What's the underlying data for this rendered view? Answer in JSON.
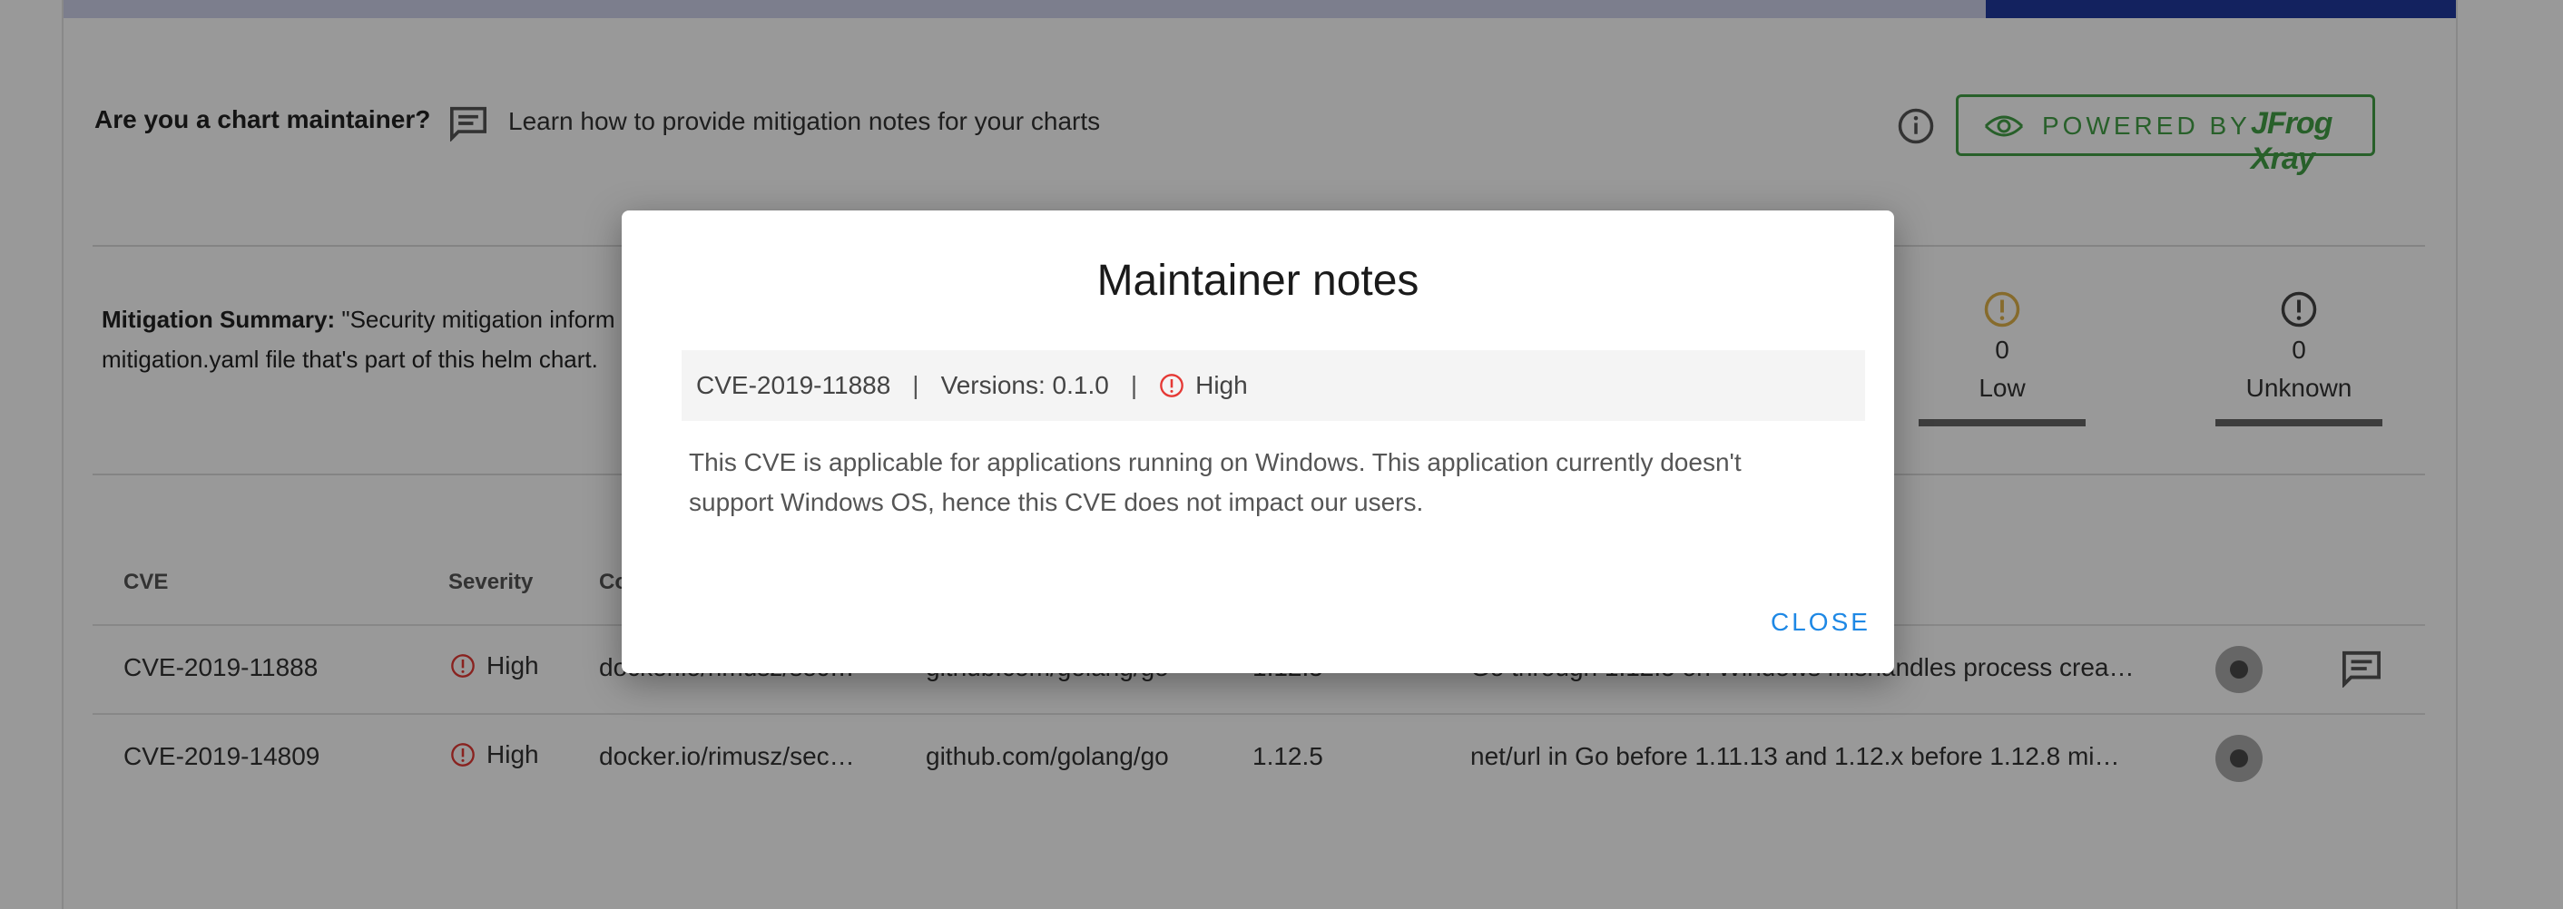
{
  "header": {
    "maintainer_question": "Are you a chart maintainer?",
    "maintainer_link": "Learn how to provide mitigation notes for your charts",
    "powered_by": "POWERED BY",
    "powered_brand": "JFrog Xray",
    "brand_color": "#43a047"
  },
  "summary": {
    "label": "Mitigation Summary:",
    "text_line1": " \"Security mitigation inform",
    "text_line2": "mitigation.yaml file that's part of this helm chart."
  },
  "severity_counts": [
    {
      "label": "Low",
      "count": "0",
      "color": "#e0b24a"
    },
    {
      "label": "Unknown",
      "count": "0",
      "color": "#444444"
    }
  ],
  "table": {
    "headers": {
      "cve": "CVE",
      "severity": "Severity",
      "component": "Co"
    },
    "rows": [
      {
        "cve": "CVE-2019-11888",
        "severity": "High",
        "component": "docker.io/rimusz/sec…",
        "package": "github.com/golang/go",
        "version": "1.12.5",
        "summary": "Go through 1.12.5 on Windows mishandles process crea…"
      },
      {
        "cve": "CVE-2019-14809",
        "severity": "High",
        "component": "docker.io/rimusz/sec…",
        "package": "github.com/golang/go",
        "version": "1.12.5",
        "summary": "net/url in Go before 1.11.13 and 1.12.x before 1.12.8 mi…"
      }
    ],
    "high_color": "#e53935"
  },
  "modal": {
    "title": "Maintainer notes",
    "cve": "CVE-2019-11888",
    "separator": "|",
    "versions": "Versions: 0.1.0",
    "severity": "High",
    "body": "This CVE is applicable for applications running on Windows. This application currently doesn't support Windows OS, hence this CVE does not impact our users.",
    "close_label": "CLOSE"
  }
}
